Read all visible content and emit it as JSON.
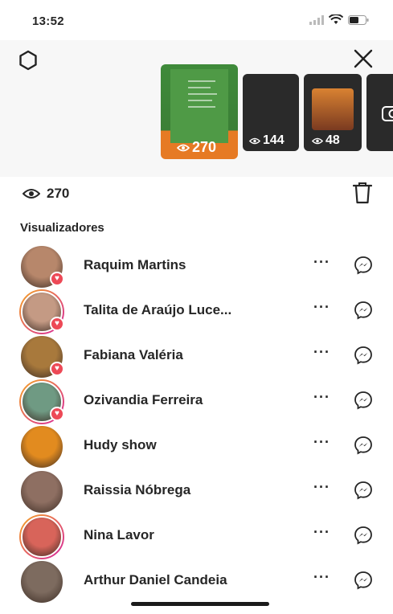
{
  "status_bar": {
    "time": "13:52"
  },
  "story": {
    "thumbnails": [
      {
        "views": "270"
      },
      {
        "views": "144"
      },
      {
        "views": "48"
      }
    ],
    "views_count": "270"
  },
  "viewers_section": {
    "title": "Visualizadores"
  },
  "viewers": [
    {
      "name": "Raquim Martins",
      "ring": false,
      "liked": true,
      "color": "#b7876b"
    },
    {
      "name": "Talita de Araújo Luce...",
      "ring": true,
      "liked": true,
      "color": "#c49a84"
    },
    {
      "name": "Fabiana Valéria",
      "ring": false,
      "liked": true,
      "color": "#a8793c"
    },
    {
      "name": "Ozivandia Ferreira",
      "ring": true,
      "liked": true,
      "color": "#6f9a83"
    },
    {
      "name": "Hudy show",
      "ring": false,
      "liked": false,
      "color": "#e28b1f"
    },
    {
      "name": "Raissia Nóbrega",
      "ring": false,
      "liked": false,
      "color": "#8e6f62"
    },
    {
      "name": "Nina Lavor",
      "ring": true,
      "liked": false,
      "color": "#d8645a"
    },
    {
      "name": "Arthur Daniel Candeia",
      "ring": false,
      "liked": false,
      "color": "#7d6b5f"
    }
  ],
  "icons": {
    "settings": "settings-icon",
    "close": "close-icon",
    "eye": "eye-icon",
    "trash": "trash-icon",
    "more": "more-icon",
    "message": "messenger-icon",
    "heart": "heart-icon"
  },
  "colors": {
    "like": "#ed4956",
    "ring_start": "#f5a623",
    "ring_end": "#d6249f"
  }
}
